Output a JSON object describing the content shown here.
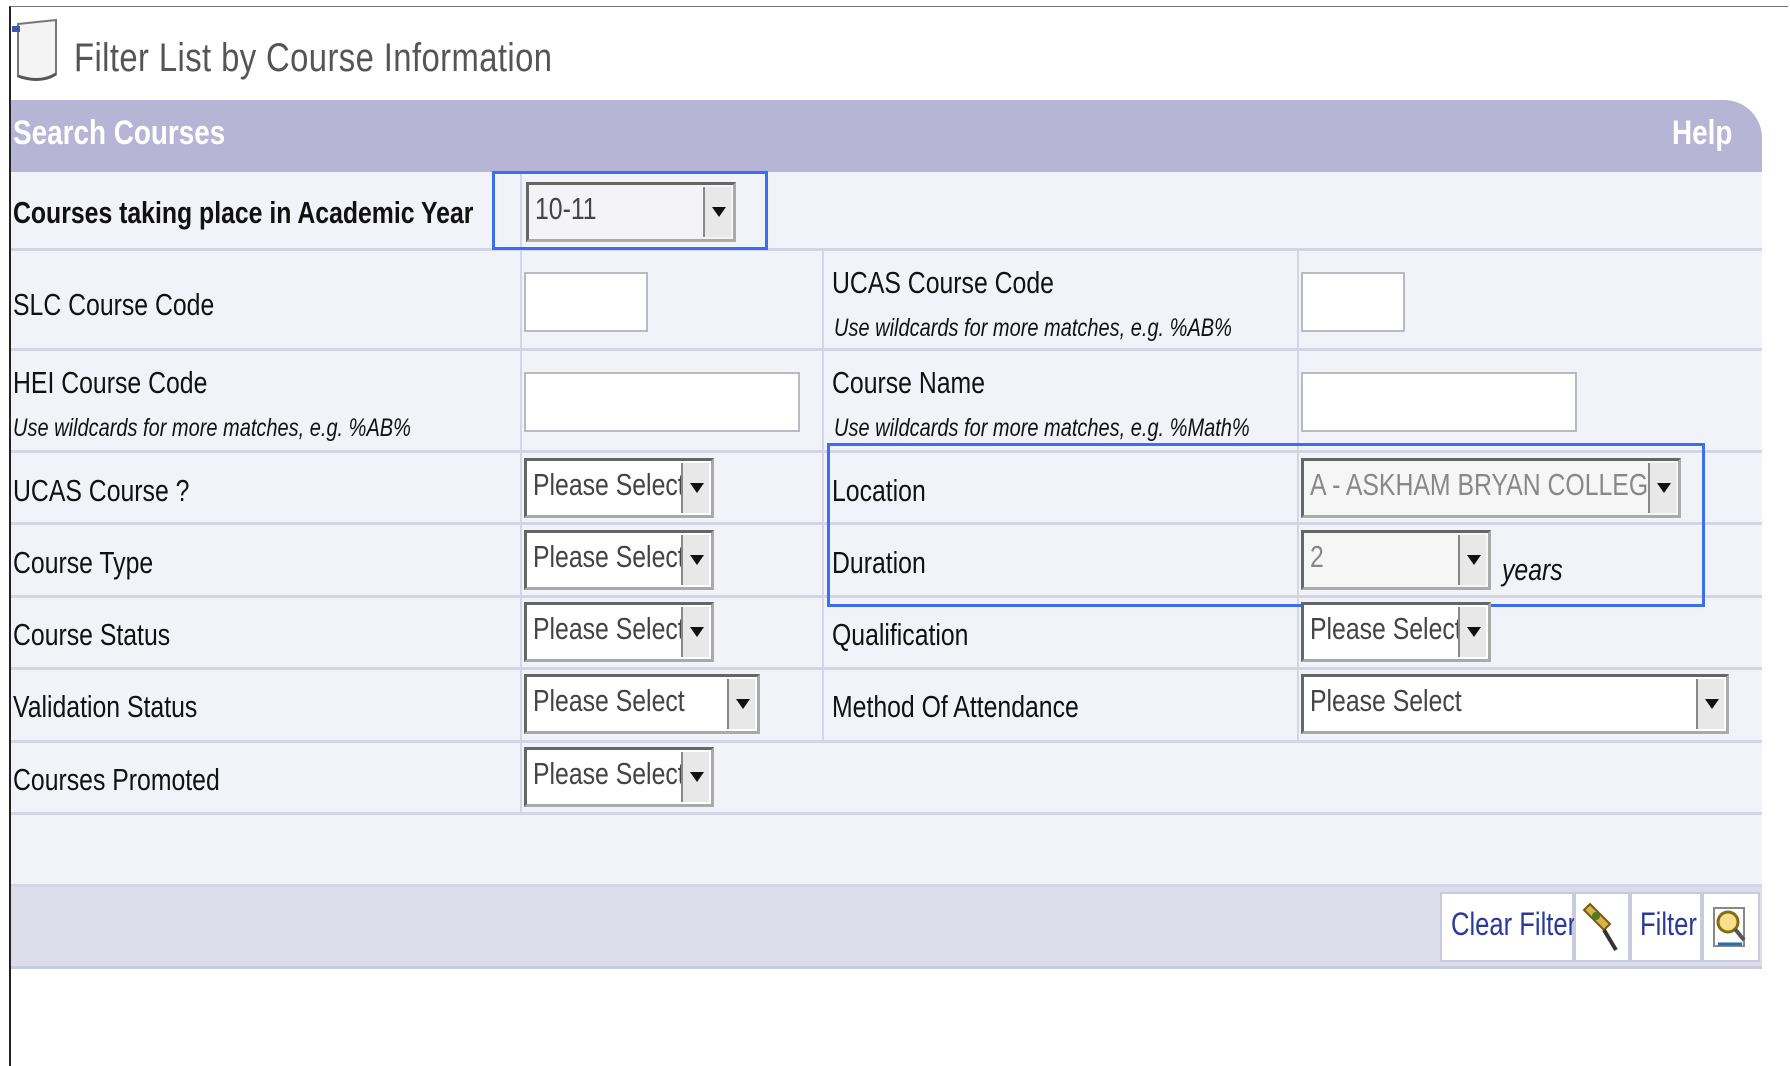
{
  "page": {
    "title": "Filter List by Course Information",
    "search_title": "Search Courses",
    "help": "Help"
  },
  "academic_year": {
    "label": "Courses taking place in Academic Year",
    "value": "10-11"
  },
  "fields": {
    "slc_code": {
      "label": "SLC Course Code"
    },
    "ucas_code": {
      "label": "UCAS Course Code",
      "hint": "Use wildcards for more matches, e.g. %AB%"
    },
    "hei_code": {
      "label": "HEI Course Code",
      "hint": "Use wildcards for more matches, e.g. %AB%"
    },
    "course_name": {
      "label": "Course Name",
      "hint": "Use wildcards for more matches, e.g. %Math%"
    },
    "ucas_course": {
      "label": "UCAS Course ?",
      "value": "Please Select"
    },
    "location": {
      "label": "Location",
      "value": "A - ASKHAM BRYAN COLLEGE"
    },
    "course_type": {
      "label": "Course Type",
      "value": "Please Select"
    },
    "duration": {
      "label": "Duration",
      "value": "2",
      "unit": "years"
    },
    "course_status": {
      "label": "Course Status",
      "value": "Please Select"
    },
    "qualification": {
      "label": "Qualification",
      "value": "Please Select"
    },
    "validation_status": {
      "label": "Validation Status",
      "value": "Please Select"
    },
    "method_of_attendance": {
      "label": "Method Of Attendance",
      "value": "Please Select"
    },
    "courses_promoted": {
      "label": "Courses Promoted",
      "value": "Please Select"
    }
  },
  "buttons": {
    "clear_filter": "Clear Filter",
    "filter": "Filter"
  },
  "icons": {
    "title": "document-icon",
    "clear": "broom-icon",
    "filter": "magnifier-document-icon"
  },
  "colors": {
    "header": "#b7b5d6",
    "row_bg": "#f2f3f9",
    "highlight": "#3a6ff0",
    "button_text": "#2a3a99"
  }
}
